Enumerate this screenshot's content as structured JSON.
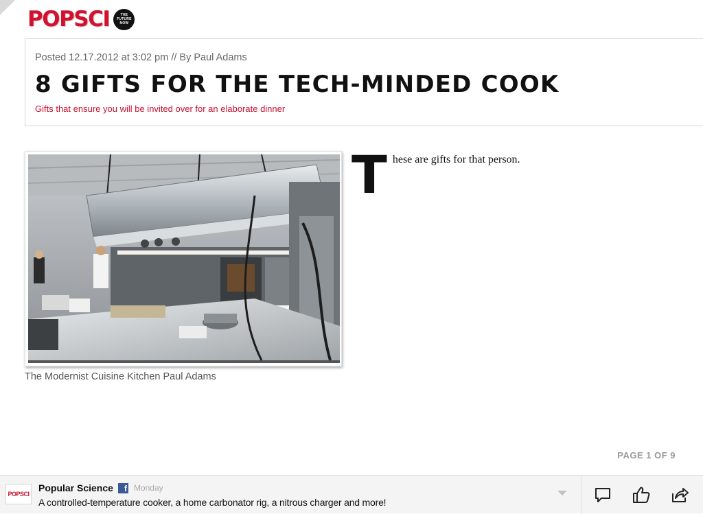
{
  "brand": {
    "logo_text": "POPSCI",
    "badge_lines": [
      "THE",
      "FUTURE",
      "NOW"
    ]
  },
  "article": {
    "posted": "Posted 12.17.2012 at 3:02 pm // By Paul Adams",
    "title": "8 GIFTS FOR THE TECH-MINDED COOK",
    "subtitle": "Gifts that ensure you will be invited over for an elaborate dinner",
    "image_caption": "The Modernist Cuisine Kitchen Paul Adams",
    "drop_cap": "T",
    "body_rest": "hese are gifts for that person."
  },
  "pagination": {
    "label": "PAGE 1 OF 9"
  },
  "share_bar": {
    "source_logo": "POPSCI",
    "source_name": "Popular Science",
    "facebook_icon": "f",
    "time": "Monday",
    "text": "A controlled-temperature cooker, a home carbonator rig, a nitrous charger and more!",
    "icons": [
      "comment-icon",
      "like-icon",
      "share-icon"
    ]
  },
  "colors": {
    "brand_red": "#d0122f",
    "facebook_blue": "#3b5998"
  }
}
